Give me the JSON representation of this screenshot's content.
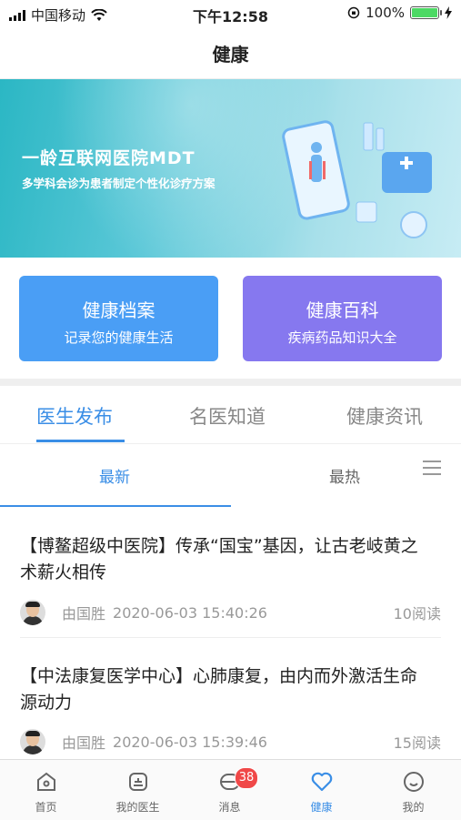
{
  "status_bar": {
    "carrier": "中国移动",
    "time": "下午12:58",
    "battery": "100%"
  },
  "nav": {
    "title": "健康"
  },
  "banner": {
    "title": "一龄互联网医院MDT",
    "subtitle": "多学科会诊为患者制定个性化诊疗方案"
  },
  "cards": [
    {
      "title": "健康档案",
      "subtitle": "记录您的健康生活",
      "color": "#4a9ef5"
    },
    {
      "title": "健康百科",
      "subtitle": "疾病药品知识大全",
      "color": "#8678ef"
    }
  ],
  "tabs": [
    "医生发布",
    "名医知道",
    "健康资讯"
  ],
  "subtabs": [
    "最新",
    "最热"
  ],
  "articles": [
    {
      "title": "【博鳌超级中医院】传承“国宝”基因，让古老岐黄之术薪火相传",
      "author": "由国胜",
      "datetime": "2020-06-03 15:40:26",
      "reads": "10阅读"
    },
    {
      "title": "【中法康复医学中心】心肺康复，由内而外激活生命源动力",
      "author": "由国胜",
      "datetime": "2020-06-03 15:39:46",
      "reads": "15阅读"
    }
  ],
  "bottom_nav": [
    {
      "label": "首页",
      "icon": "home-icon"
    },
    {
      "label": "我的医生",
      "icon": "doctor-icon"
    },
    {
      "label": "消息",
      "icon": "message-icon",
      "badge": "38"
    },
    {
      "label": "健康",
      "icon": "heart-icon"
    },
    {
      "label": "我的",
      "icon": "profile-icon"
    }
  ],
  "accent_color": "#3a8ee6"
}
